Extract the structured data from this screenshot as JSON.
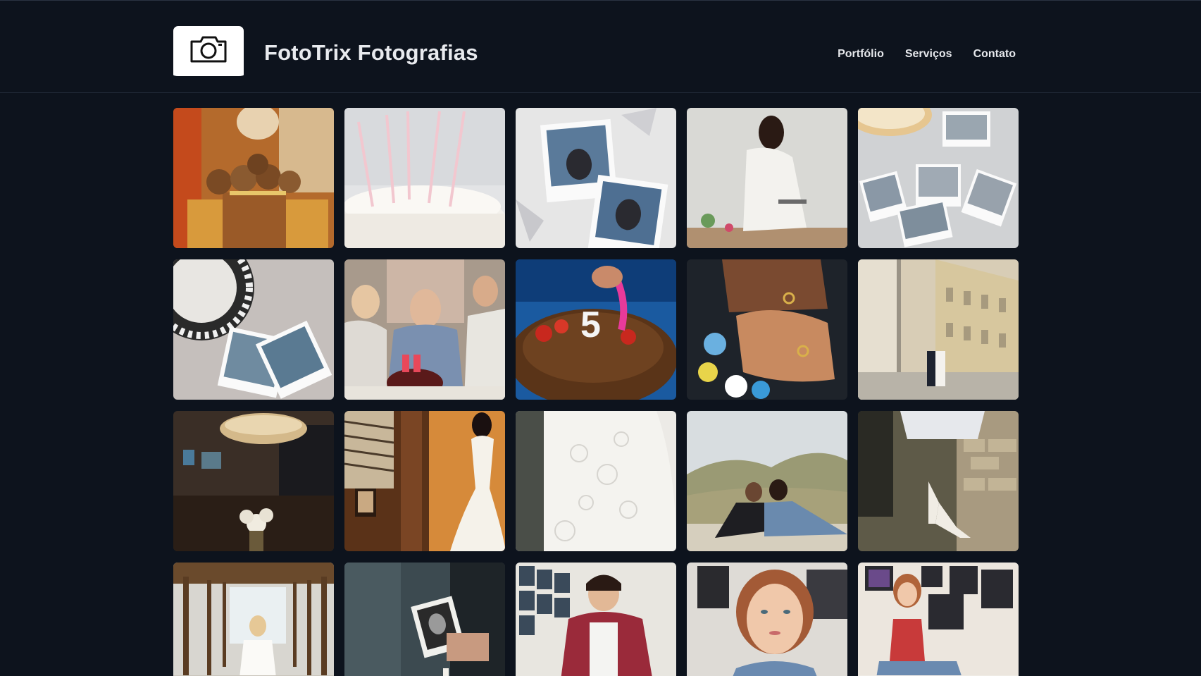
{
  "header": {
    "title": "FotoTrix Fotografias",
    "logo_icon": "camera-icon"
  },
  "nav": {
    "items": [
      {
        "label": "Portfólio"
      },
      {
        "label": "Serviços"
      },
      {
        "label": "Contato"
      }
    ]
  },
  "gallery": {
    "photos": [
      {
        "name": "chocolate-lollipops-photo"
      },
      {
        "name": "birthday-cake-candles-photo"
      },
      {
        "name": "polaroid-photos-photo"
      },
      {
        "name": "woman-setting-table-photo"
      },
      {
        "name": "polaroids-and-pie-photo"
      },
      {
        "name": "plate-and-polaroids-photo"
      },
      {
        "name": "grandfather-birthday-74-photo"
      },
      {
        "name": "cake-number-5-photo"
      },
      {
        "name": "wedding-rings-hands-photo"
      },
      {
        "name": "couple-by-building-photo"
      },
      {
        "name": "chandelier-bouquet-photo"
      },
      {
        "name": "wedding-dress-mannequin-photo"
      },
      {
        "name": "lace-dress-detail-photo"
      },
      {
        "name": "couple-in-field-photo"
      },
      {
        "name": "bridal-shoes-photo"
      },
      {
        "name": "bride-in-corridor-photo"
      },
      {
        "name": "photo-frame-hand-photo"
      },
      {
        "name": "man-reading-photo"
      },
      {
        "name": "red-haired-woman-portrait-photo"
      },
      {
        "name": "woman-sitting-photo-wall-photo"
      }
    ]
  }
}
